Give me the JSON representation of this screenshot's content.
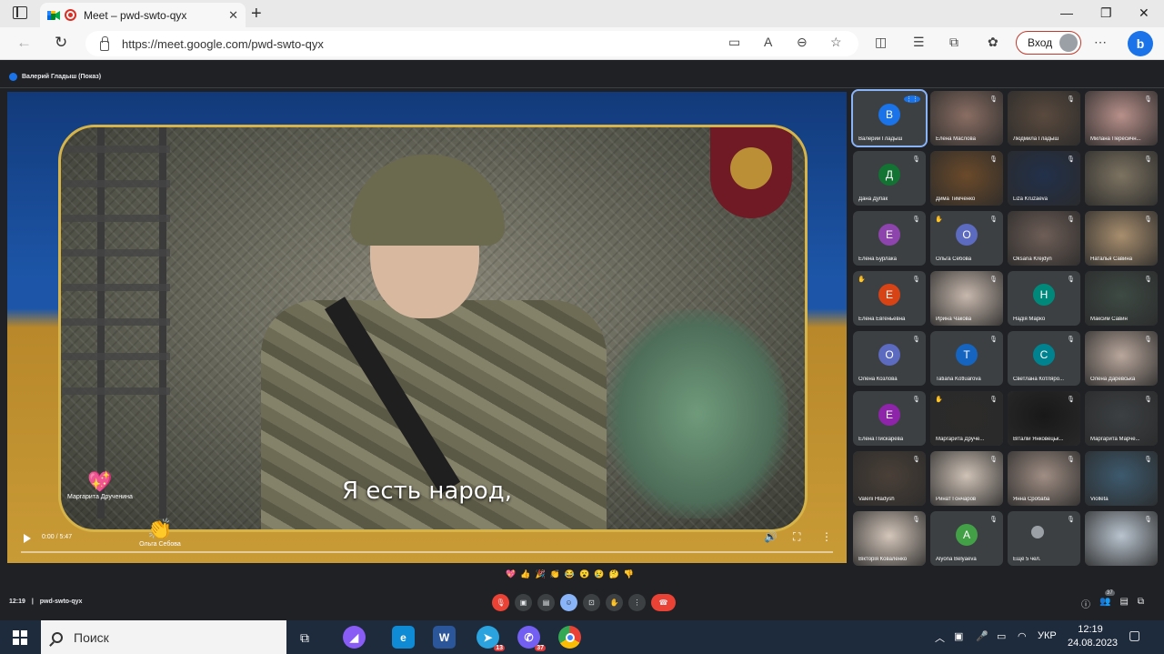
{
  "browser": {
    "tab_title": "Meet – pwd-swto-qyx",
    "url": "https://meet.google.com/pwd-swto-qyx",
    "login_label": "Вход",
    "icons": [
      "sidebar-icon",
      "record-icon",
      "close-icon",
      "plus-icon",
      "back-icon",
      "refresh-icon",
      "lock-icon",
      "camera-icon",
      "read-aloud-icon",
      "zoom-icon",
      "favorite-icon",
      "split-icon",
      "favorites-icon",
      "collections-icon",
      "extensions-icon",
      "more-icon",
      "bing-icon"
    ]
  },
  "meet": {
    "presenter": "Валерий Гладыш (Показ)",
    "subtitle": "Я есть народ,",
    "video_time": "0:00 / 5:47",
    "reactions": [
      {
        "emoji": "💖",
        "name": "Маргарита Друченина"
      },
      {
        "emoji": "👏",
        "name": "Ольга Себова"
      }
    ],
    "emoji_bar": [
      "💖",
      "👍",
      "🎉",
      "👏",
      "😂",
      "😮",
      "😢",
      "🤔",
      "👎"
    ],
    "clock": "12:19",
    "meeting_code": "pwd-swto-qyx",
    "people_count": "37",
    "accent_red": "#ea4335",
    "accent_blue": "#8ab4f8"
  },
  "participants": [
    {
      "name": "Валерий Гладыш",
      "initial": "В",
      "color": "#1a73e8",
      "type": "avatar",
      "speaking": true
    },
    {
      "name": "Елена Маслова",
      "type": "photo",
      "tone": "#8a6e63"
    },
    {
      "name": "Людмила Гладыш",
      "type": "photo",
      "tone": "#5a4a3e"
    },
    {
      "name": "Милана Пересичн...",
      "type": "photo",
      "tone": "#b8908a"
    },
    {
      "name": "Дана Дупак",
      "initial": "Д",
      "color": "#137333",
      "type": "avatar"
    },
    {
      "name": "Дима Тимченко",
      "type": "photo",
      "tone": "#6b4a2a"
    },
    {
      "name": "Liza Kruzaeva",
      "type": "photo",
      "tone": "#22304a"
    },
    {
      "name": "",
      "type": "photo",
      "tone": "#7d7361"
    },
    {
      "name": "Елена Бурлака",
      "initial": "Е",
      "color": "#8e44ad",
      "type": "avatar"
    },
    {
      "name": "Ольга Себова",
      "initial": "О",
      "color": "#5c6bc0",
      "type": "avatar",
      "hand": true
    },
    {
      "name": "Oksana Krejdyn",
      "type": "photo",
      "tone": "#6e5e57"
    },
    {
      "name": "Наталья Савина",
      "type": "photo",
      "tone": "#a88e6e"
    },
    {
      "name": "Елена Евгеньевна",
      "initial": "Е",
      "color": "#d84315",
      "type": "avatar",
      "hand": true
    },
    {
      "name": "Ирина Чакова",
      "type": "photo",
      "tone": "#c7b8ad"
    },
    {
      "name": "Надія Марко",
      "initial": "Н",
      "color": "#00897b",
      "type": "avatar"
    },
    {
      "name": "Максим Савин",
      "type": "photo",
      "tone": "#3e4a44"
    },
    {
      "name": "Олена Козлова",
      "initial": "О",
      "color": "#5c6bc0",
      "type": "avatar"
    },
    {
      "name": "Tatiana Kotluarova",
      "initial": "T",
      "color": "#1565c0",
      "type": "avatar"
    },
    {
      "name": "Светлана Котляро...",
      "initial": "С",
      "color": "#00838f",
      "type": "avatar"
    },
    {
      "name": "Олена Даревська",
      "type": "photo",
      "tone": "#b9a79c"
    },
    {
      "name": "Елена Пискарева",
      "initial": "Е",
      "color": "#8e24aa",
      "type": "avatar"
    },
    {
      "name": "Маргарита Друче...",
      "type": "photo",
      "tone": "#2c2b2a",
      "hand": true
    },
    {
      "name": "Віталій Янковецьк...",
      "type": "photo",
      "tone": "#181818"
    },
    {
      "name": "Маргарита Марче...",
      "type": "photo",
      "tone": "#3c4043"
    },
    {
      "name": "Valerii Hladysh",
      "type": "photo",
      "tone": "#4a4038"
    },
    {
      "name": "Ринат Гончаров",
      "type": "photo",
      "tone": "#cfc2b6"
    },
    {
      "name": "Янна Сробаба",
      "type": "photo",
      "tone": "#a08e84"
    },
    {
      "name": "Violleta",
      "type": "photo",
      "tone": "#3d5a6e"
    },
    {
      "name": "Вікторія Коваленко",
      "type": "photo",
      "tone": "#d4c6ba"
    },
    {
      "name": "Alyona Belyaeva",
      "initial": "A",
      "color": "#43a047",
      "type": "avatar"
    },
    {
      "name": "Ещё 5 чел.",
      "type": "more"
    },
    {
      "name": "",
      "type": "photo",
      "tone": "#b9c4cf"
    }
  ],
  "taskbar": {
    "search_placeholder": "Поиск",
    "telegram_badge": "13",
    "viber_badge": "37",
    "lang": "УКР",
    "time": "12:19",
    "date": "24.08.2023"
  }
}
